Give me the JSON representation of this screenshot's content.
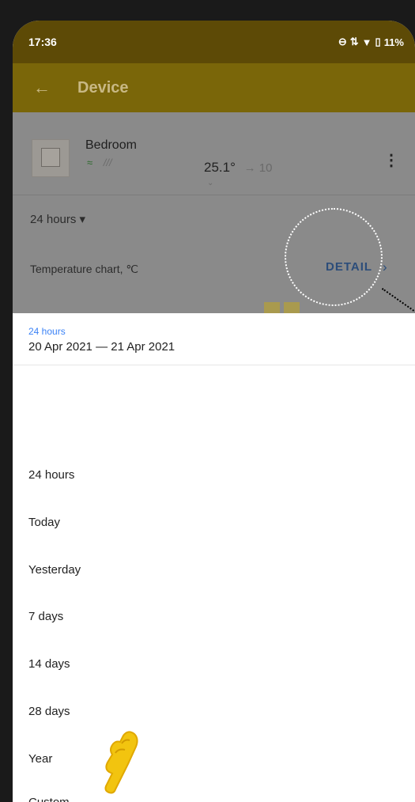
{
  "status_bar": {
    "time": "17:36",
    "battery": "11%"
  },
  "app_bar": {
    "title": "Device"
  },
  "device": {
    "name": "Bedroom",
    "current_temp": "25.1°",
    "target_temp": "→ 10",
    "more_icon": "more-vert-icon"
  },
  "period_select": {
    "label": "24 hours ▾"
  },
  "chart": {
    "label": "Temperature chart, ℃",
    "detail_label": "DETAIL"
  },
  "sheet": {
    "subtitle": "24 hours",
    "range": "20 Apr 2021 — 21 Apr 2021",
    "options": [
      "24 hours",
      "Today",
      "Yesterday",
      "7 days",
      "14 days",
      "28 days",
      "Year",
      "Custom..."
    ]
  },
  "colors": {
    "accent": "#f2c40f",
    "app_bar": "#7a6609",
    "link": "#2c4d7a",
    "subtitle": "#3b82f6"
  }
}
